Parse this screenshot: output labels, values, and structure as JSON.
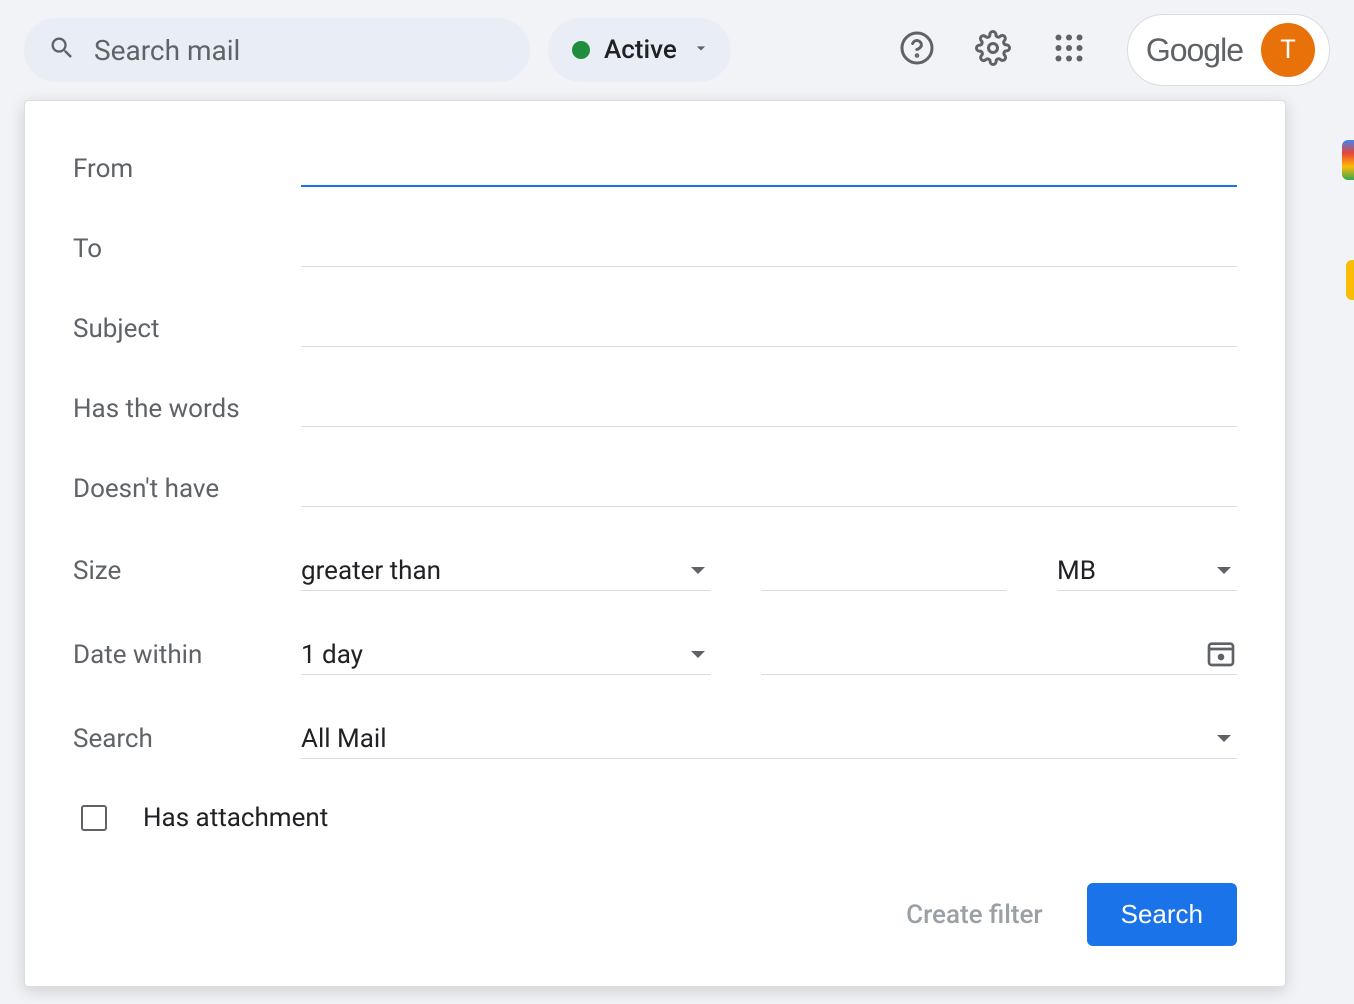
{
  "header": {
    "search_placeholder": "Search mail",
    "status_label": "Active",
    "brand": "Google",
    "avatar_initial": "T"
  },
  "filter": {
    "from_label": "From",
    "to_label": "To",
    "subject_label": "Subject",
    "has_words_label": "Has the words",
    "doesnt_have_label": "Doesn't have",
    "size_label": "Size",
    "size_comparator": "greater than",
    "size_unit": "MB",
    "date_within_label": "Date within",
    "date_within_value": "1 day",
    "search_label": "Search",
    "search_scope": "All Mail",
    "has_attachment_label": "Has attachment"
  },
  "actions": {
    "create_filter": "Create filter",
    "search": "Search"
  }
}
